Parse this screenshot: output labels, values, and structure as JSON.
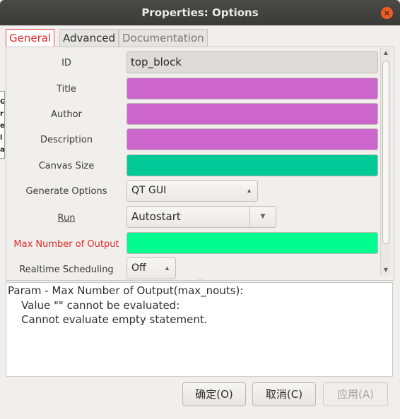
{
  "window": {
    "title": "Properties: Options"
  },
  "tabs": [
    {
      "label": "General"
    },
    {
      "label": "Advanced"
    },
    {
      "label": "Documentation"
    }
  ],
  "params": {
    "id": {
      "label": "ID",
      "value": "top_block"
    },
    "title": {
      "label": "Title",
      "value": "",
      "color": "#cd66cc"
    },
    "author": {
      "label": "Author",
      "value": "",
      "color": "#cd66cc"
    },
    "description": {
      "label": "Description",
      "value": "",
      "color": "#cd66cc"
    },
    "canvas_size": {
      "label": "Canvas Size",
      "value": "",
      "color": "#00c896"
    },
    "generate_options": {
      "label": "Generate Options",
      "value": "QT GUI"
    },
    "run": {
      "label": "Run",
      "value": "Autostart"
    },
    "max_outputs": {
      "label": "Max Number of Output",
      "value": "",
      "color": "#00fc8f"
    },
    "realtime": {
      "label": "Realtime Scheduling",
      "value": "Off"
    }
  },
  "error": {
    "line1": "Param - Max Number of Output(max_nouts):",
    "line2": "    Value \"\" cannot be evaluated:",
    "line3": "    Cannot evaluate empty statement."
  },
  "buttons": {
    "ok": "确定(O)",
    "cancel": "取消(C)",
    "apply": "应用(A)"
  },
  "sidebar_fragment": [
    "G",
    "r",
    "e l",
    "al"
  ],
  "icons": {
    "close": "close-icon",
    "spin": "spin-arrows-icon",
    "dropdown": "chevron-down-icon"
  }
}
